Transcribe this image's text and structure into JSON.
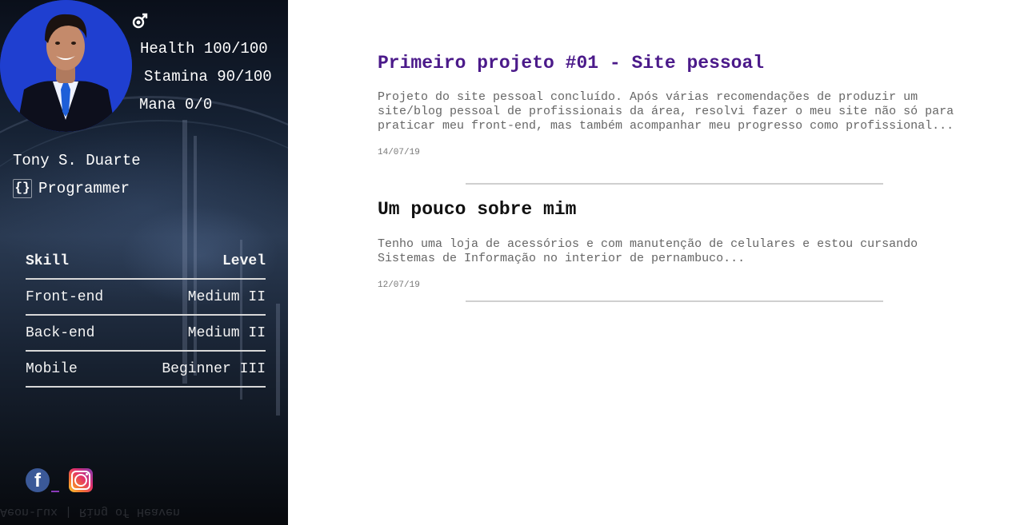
{
  "profile": {
    "stats": {
      "health": "Health 100/100",
      "stamina": "Stamina 90/100",
      "mana": "Mana 0/0"
    },
    "name": "Tony S. Duarte",
    "role_icon": "{}",
    "role": "Programmer"
  },
  "skills": {
    "header": {
      "skill": "Skill",
      "level": "Level"
    },
    "rows": [
      {
        "skill": "Front-end",
        "level": "Medium II"
      },
      {
        "skill": "Back-end",
        "level": "Medium II"
      },
      {
        "skill": "Mobile",
        "level": "Beginner III"
      }
    ]
  },
  "social": {
    "facebook_icon": "facebook-icon",
    "facebook_glyph": "f",
    "instagram_icon": "instagram-icon"
  },
  "background_watermark": "Aeon-Lux | Ring of Heaven",
  "posts": [
    {
      "title": "Primeiro projeto #01 - Site pessoal",
      "body": "Projeto do site pessoal concluído. Após várias recomendações de produzir um site/blog pessoal de profissionais da área, resolvi fazer o meu site não só para praticar meu front-end, mas também acompanhar meu progresso como profissional...",
      "date": "14/07/19",
      "title_color": "#4b1a8a"
    },
    {
      "title": "Um pouco sobre mim",
      "body": "Tenho uma loja de acessórios e com manutenção de celulares e estou cursando Sistemas de Informação no interior de pernambuco...",
      "date": "12/07/19",
      "title_color": "#111111"
    }
  ],
  "colors": {
    "sidebar_text": "#ffffff",
    "post_body": "#666666",
    "divider": "#cfcfcf",
    "avatar_bg": "#1f3fd0"
  }
}
